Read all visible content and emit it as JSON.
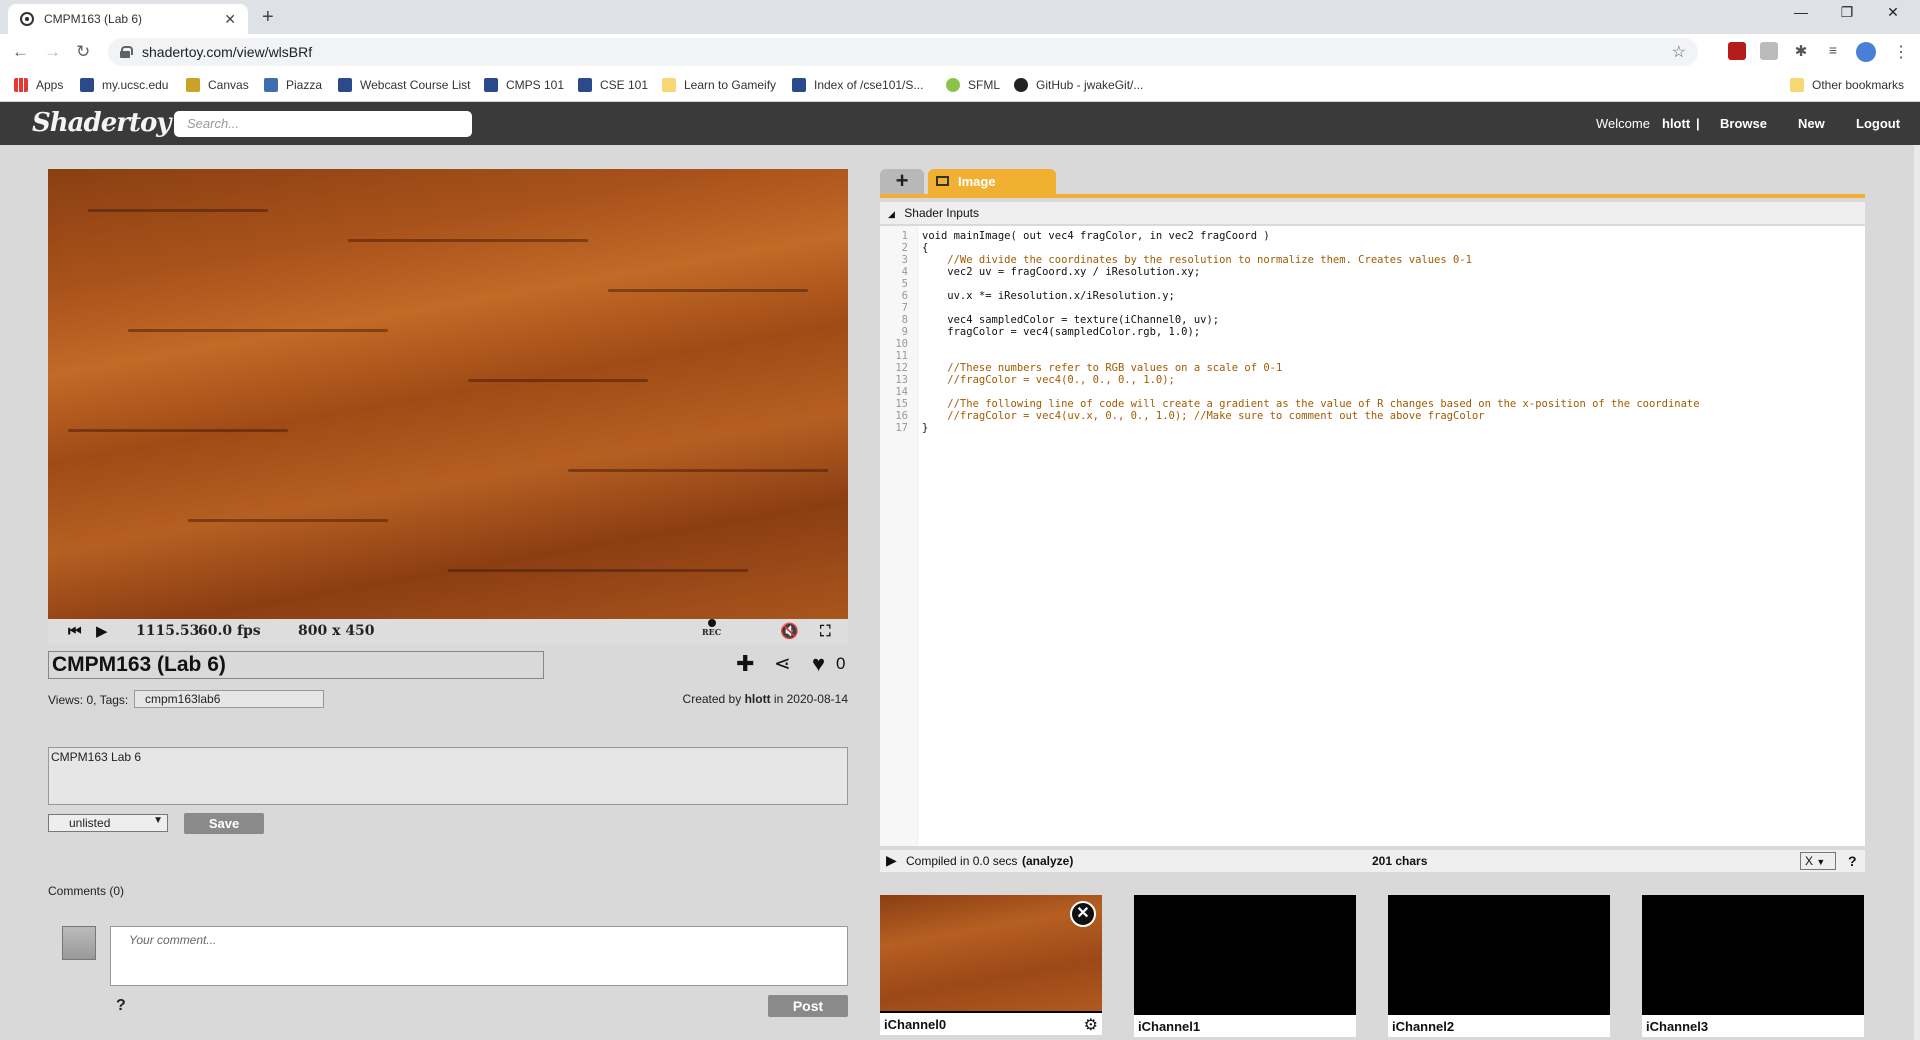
{
  "browser": {
    "tab_title": "CMPM163 (Lab 6)",
    "url": "shadertoy.com/view/wlsBRf",
    "bookmarks": [
      "Apps",
      "my.ucsc.edu",
      "Canvas",
      "Piazza",
      "Webcast Course List",
      "CMPS 101",
      "CSE 101",
      "Learn to Gameify",
      "Index of /cse101/S...",
      "SFML",
      "GitHub - jwakeGit/..."
    ],
    "other_bookmarks": "Other bookmarks"
  },
  "header": {
    "logo": "Shadertoy",
    "search_placeholder": "Search...",
    "welcome": "Welcome",
    "user": "hlott",
    "separator": "|",
    "browse": "Browse",
    "new": "New",
    "logout": "Logout"
  },
  "player": {
    "time": "1115.53",
    "fps": "60.0 fps",
    "resolution": "800 x 450",
    "rec_label": "REC"
  },
  "shader": {
    "title": "CMPM163 (Lab 6)",
    "likes": "0",
    "views_label": "Views: 0, Tags:",
    "tags": "cmpm163lab6",
    "created_prefix": "Created by",
    "author": "hlott",
    "created_in": "in",
    "date": "2020-08-14",
    "description": "CMPM163 Lab 6",
    "visibility": "unlisted",
    "save_label": "Save"
  },
  "comments": {
    "header": "Comments (0)",
    "placeholder": "Your comment...",
    "help": "?",
    "post_label": "Post"
  },
  "editor": {
    "add_tab": "+",
    "image_tab": "Image",
    "shader_inputs": "Shader Inputs",
    "compiled_text": "Compiled in 0.0 secs",
    "analyze": "(analyze)",
    "chars": "201 chars",
    "close_x": "X",
    "help": "?",
    "lines": [
      "1",
      "2",
      "3",
      "4",
      "5",
      "6",
      "7",
      "8",
      "9",
      "10",
      "11",
      "12",
      "13",
      "14",
      "15",
      "16",
      "17"
    ],
    "code": {
      "l1": "void mainImage( out vec4 fragColor, in vec2 fragCoord )",
      "l2": "{",
      "l3": "    //We divide the coordinates by the resolution to normalize them. Creates values 0-1",
      "l4": "    vec2 uv = fragCoord.xy / iResolution.xy;",
      "l6": "    uv.x *= iResolution.x/iResolution.y;",
      "l8": "    vec4 sampledColor = texture(iChannel0, uv);",
      "l9": "    fragColor = vec4(sampledColor.rgb, 1.0);",
      "l12": "    //These numbers refer to RGB values on a scale of 0-1",
      "l13": "    //fragColor = vec4(0., 0., 0., 1.0);",
      "l15": "    //The following line of code will create a gradient as the value of R changes based on the x-position of the coordinate",
      "l16": "    //fragColor = vec4(uv.x, 0., 0., 1.0); //Make sure to comment out the above fragColor",
      "l17": "}"
    }
  },
  "channels": [
    "iChannel0",
    "iChannel1",
    "iChannel2",
    "iChannel3"
  ]
}
